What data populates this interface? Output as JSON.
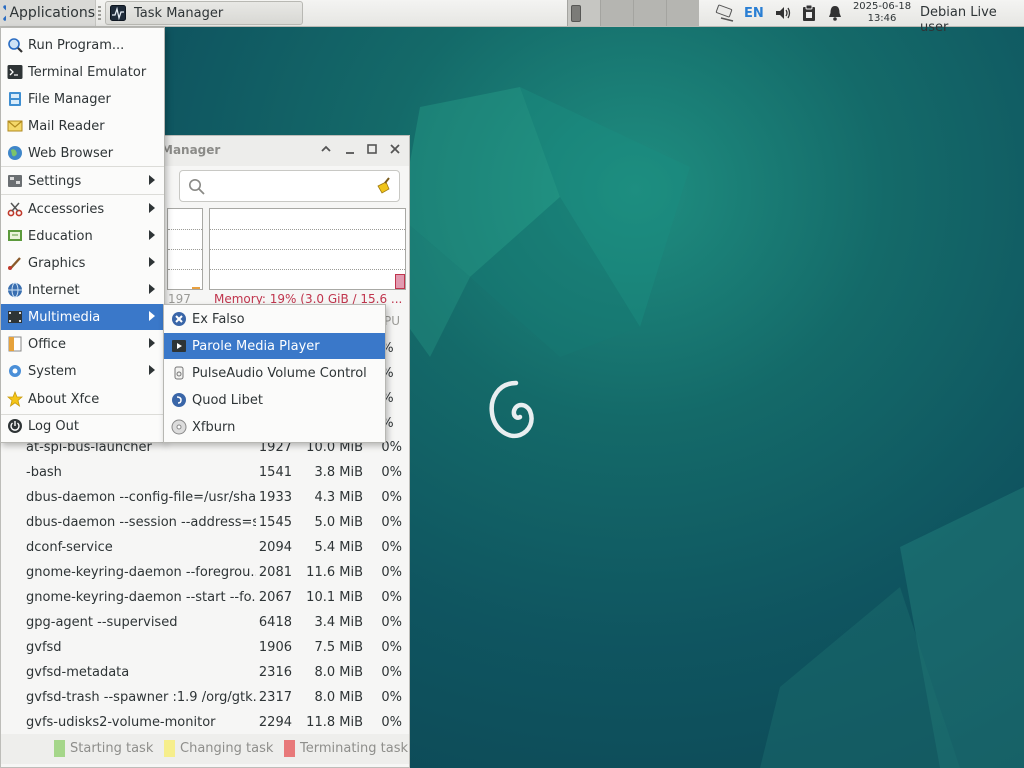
{
  "panel": {
    "applications_label": "Applications",
    "task_button_label": "Task Manager",
    "language": "EN",
    "clock_date": "2025-06-18",
    "clock_time": "13:46",
    "user": "Debian Live user"
  },
  "task_manager": {
    "title_partial": "Manager",
    "search_value": "",
    "cpu_partial": "197",
    "memory_text": "Memory: 19% (3.0 GiB / 15.6 ...",
    "col_cpu_partial": "PU",
    "hidden_cpu_values": [
      "0%",
      "0%",
      "0%",
      "0%"
    ],
    "processes": [
      {
        "name": "at-spi-bus-launcher",
        "pid": "1927",
        "mem": "10.0 MiB",
        "cpu": "0%"
      },
      {
        "name": "-bash",
        "pid": "1541",
        "mem": "3.8 MiB",
        "cpu": "0%"
      },
      {
        "name": "dbus-daemon --config-file=/usr/sha...",
        "pid": "1933",
        "mem": "4.3 MiB",
        "cpu": "0%"
      },
      {
        "name": "dbus-daemon --session --address=s...",
        "pid": "1545",
        "mem": "5.0 MiB",
        "cpu": "0%"
      },
      {
        "name": "dconf-service",
        "pid": "2094",
        "mem": "5.4 MiB",
        "cpu": "0%"
      },
      {
        "name": "gnome-keyring-daemon --foregrou...",
        "pid": "2081",
        "mem": "11.6 MiB",
        "cpu": "0%"
      },
      {
        "name": "gnome-keyring-daemon --start --fo...",
        "pid": "2067",
        "mem": "10.1 MiB",
        "cpu": "0%"
      },
      {
        "name": "gpg-agent --supervised",
        "pid": "6418",
        "mem": "3.4 MiB",
        "cpu": "0%"
      },
      {
        "name": "gvfsd",
        "pid": "1906",
        "mem": "7.5 MiB",
        "cpu": "0%"
      },
      {
        "name": "gvfsd-metadata",
        "pid": "2316",
        "mem": "8.0 MiB",
        "cpu": "0%"
      },
      {
        "name": "gvfsd-trash --spawner :1.9 /org/gtk...",
        "pid": "2317",
        "mem": "8.0 MiB",
        "cpu": "0%"
      },
      {
        "name": "gvfs-udisks2-volume-monitor",
        "pid": "2294",
        "mem": "11.8 MiB",
        "cpu": "0%"
      }
    ],
    "legend": [
      {
        "label": "Starting task",
        "color": "#a5d68a"
      },
      {
        "label": "Changing task",
        "color": "#f6ee8c"
      },
      {
        "label": "Terminating task",
        "color": "#e8797a"
      }
    ]
  },
  "app_menu": {
    "items": [
      {
        "label": "Run Program...",
        "icon": "run-program-icon"
      },
      {
        "label": "Terminal Emulator",
        "icon": "terminal-icon"
      },
      {
        "label": "File Manager",
        "icon": "file-manager-icon"
      },
      {
        "label": "Mail Reader",
        "icon": "mail-icon"
      },
      {
        "label": "Web Browser",
        "icon": "web-browser-icon"
      },
      {
        "label": "Settings",
        "icon": "settings-icon"
      },
      {
        "label": "Accessories",
        "icon": "accessories-icon"
      },
      {
        "label": "Education",
        "icon": "education-icon"
      },
      {
        "label": "Graphics",
        "icon": "graphics-icon"
      },
      {
        "label": "Internet",
        "icon": "internet-icon"
      },
      {
        "label": "Multimedia",
        "icon": "multimedia-icon"
      },
      {
        "label": "Office",
        "icon": "office-icon"
      },
      {
        "label": "System",
        "icon": "system-icon"
      },
      {
        "label": "About Xfce",
        "icon": "star-icon"
      },
      {
        "label": "Log Out",
        "icon": "logout-icon"
      }
    ],
    "highlight_color": "#3a78c9"
  },
  "multimedia_submenu": {
    "items": [
      {
        "label": "Ex Falso",
        "icon": "ex-falso-icon"
      },
      {
        "label": "Parole Media Player",
        "icon": "parole-icon"
      },
      {
        "label": "PulseAudio Volume Control",
        "icon": "pulseaudio-icon"
      },
      {
        "label": "Quod Libet",
        "icon": "quod-libet-icon"
      },
      {
        "label": "Xfburn",
        "icon": "xfburn-icon"
      }
    ]
  }
}
